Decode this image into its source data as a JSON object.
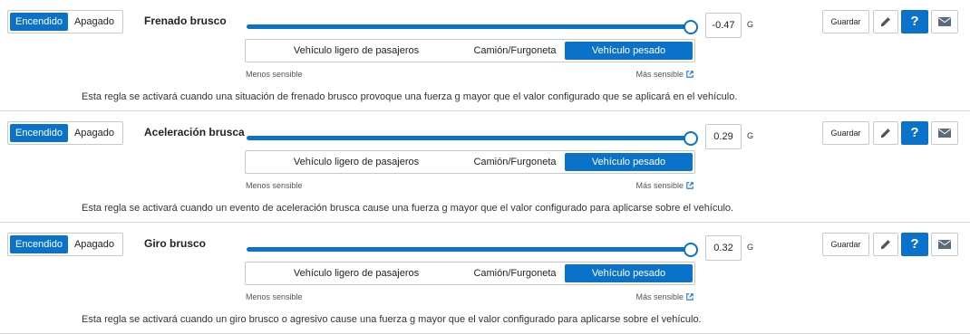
{
  "colors": {
    "accent": "#0b72c9",
    "border": "#c9c9c9"
  },
  "rules": [
    {
      "toggle_on": "Encendido",
      "toggle_off": "Apagado",
      "title": "Frenado brusco",
      "value": "-0.47",
      "slider_level": 1.0,
      "unit": "G",
      "vehicle_options": [
        "Vehículo ligero de pasajeros",
        "Camión/Furgoneta",
        "Vehículo pesado"
      ],
      "selected_vehicle": "Vehículo pesado",
      "less_sensitive": "Menos sensible",
      "more_sensitive": "Más sensible",
      "description": "Esta regla se activará cuando una situación de frenado brusco provoque una fuerza g mayor que el valor configurado que se aplicará en el vehículo.",
      "save": "Guardar",
      "help": "?"
    },
    {
      "toggle_on": "Encendido",
      "toggle_off": "Apagado",
      "title": "Aceleración brusca",
      "value": "0.29",
      "slider_level": 1.0,
      "unit": "G",
      "vehicle_options": [
        "Vehículo ligero de pasajeros",
        "Camión/Furgoneta",
        "Vehículo pesado"
      ],
      "selected_vehicle": "Vehículo pesado",
      "less_sensitive": "Menos sensible",
      "more_sensitive": "Más sensible",
      "description": "Esta regla se activará cuando un evento de aceleración brusca cause una fuerza g mayor que el valor configurado para aplicarse sobre el vehículo.",
      "save": "Guardar",
      "help": "?"
    },
    {
      "toggle_on": "Encendido",
      "toggle_off": "Apagado",
      "title": "Giro brusco",
      "value": "0.32",
      "slider_level": 1.0,
      "unit": "G",
      "vehicle_options": [
        "Vehículo ligero de pasajeros",
        "Camión/Furgoneta",
        "Vehículo pesado"
      ],
      "selected_vehicle": "Vehículo pesado",
      "less_sensitive": "Menos sensible",
      "more_sensitive": "Más sensible",
      "description": "Esta regla se activará cuando un giro brusco o agresivo cause una fuerza g mayor que el valor configurado para aplicarse sobre el vehículo.",
      "save": "Guardar",
      "help": "?"
    }
  ]
}
